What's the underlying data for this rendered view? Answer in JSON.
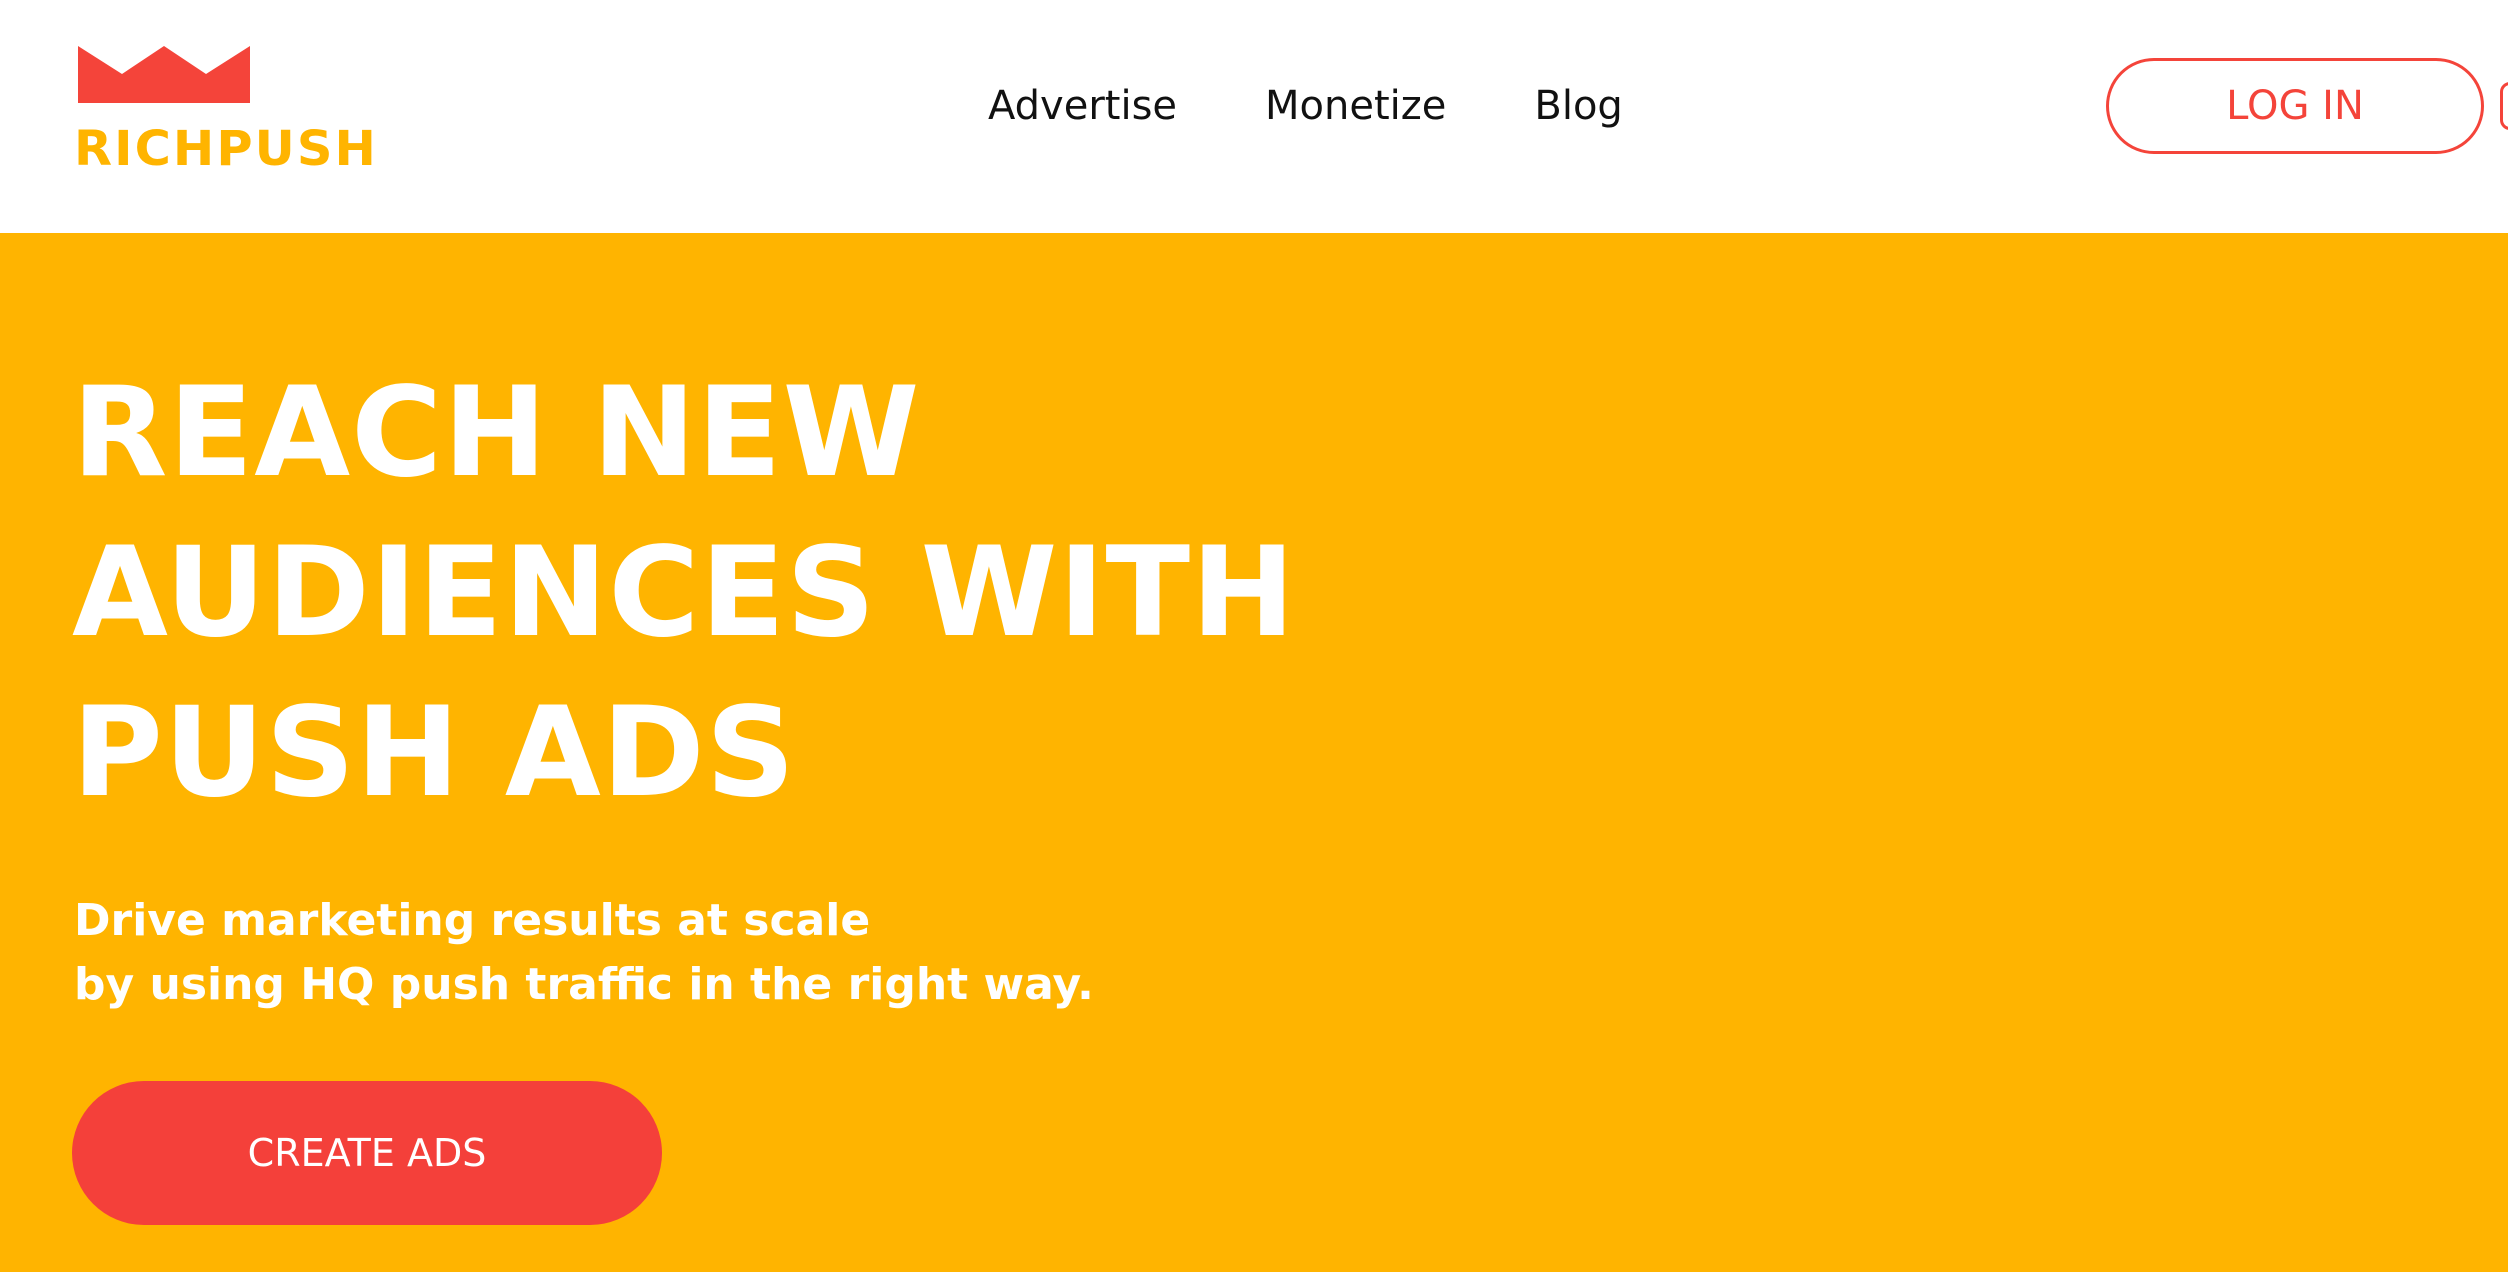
{
  "colors": {
    "brand_yellow": "#ffb400",
    "accent_red": "#f4443a",
    "cta_red": "#f4403a",
    "nav_text": "#111111",
    "white": "#ffffff"
  },
  "header": {
    "logo": {
      "icon": "crown-icon",
      "text": "RICHPUSH"
    },
    "nav": [
      "Advertise",
      "Monetize",
      "Blog"
    ],
    "login_label": "LOG IN"
  },
  "hero": {
    "title_lines": [
      "REACH NEW",
      "AUDIENCES WITH",
      "PUSH ADS"
    ],
    "subtitle_lines": [
      "Drive marketing results at scale",
      "by using HQ push traffic in the right way."
    ],
    "cta_label": "CREATE ADS"
  }
}
